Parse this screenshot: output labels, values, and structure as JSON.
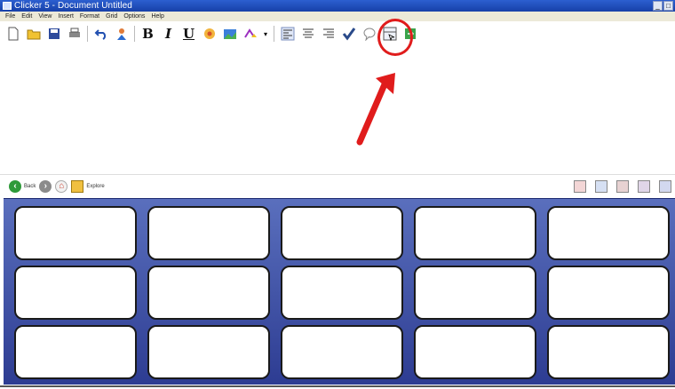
{
  "window": {
    "title": "Clicker 5 - Document Untitled",
    "controls": [
      "_",
      "□"
    ]
  },
  "menu": [
    "File",
    "Edit",
    "View",
    "Insert",
    "Format",
    "Grid",
    "Options",
    "Help"
  ],
  "toolbar": {
    "bold": "B",
    "italic": "I",
    "underline": "U",
    "highlighted_tool": "grid-view-icon"
  },
  "gridbar": {
    "back_label": "Back",
    "explore_label": "Explore"
  },
  "cells": [
    {
      "row": 1,
      "col": 1,
      "label": ""
    },
    {
      "row": 1,
      "col": 2,
      "label": ""
    },
    {
      "row": 1,
      "col": 3,
      "label": ""
    },
    {
      "row": 1,
      "col": 4,
      "label": ""
    },
    {
      "row": 1,
      "col": 5,
      "label": ""
    },
    {
      "row": 2,
      "col": 1,
      "label": ""
    },
    {
      "row": 2,
      "col": 2,
      "label": ""
    },
    {
      "row": 2,
      "col": 3,
      "label": ""
    },
    {
      "row": 2,
      "col": 4,
      "label": ""
    },
    {
      "row": 2,
      "col": 5,
      "label": ""
    },
    {
      "row": 3,
      "col": 1,
      "label": ""
    },
    {
      "row": 3,
      "col": 2,
      "label": ""
    },
    {
      "row": 3,
      "col": 3,
      "label": ""
    },
    {
      "row": 3,
      "col": 4,
      "label": ""
    },
    {
      "row": 3,
      "col": 5,
      "label": ""
    }
  ],
  "colors": {
    "titlebar": "#2c5fd0",
    "panel_top": "#5a6fbd",
    "panel_bottom": "#2d3c92",
    "annotation": "#e01c1c"
  }
}
